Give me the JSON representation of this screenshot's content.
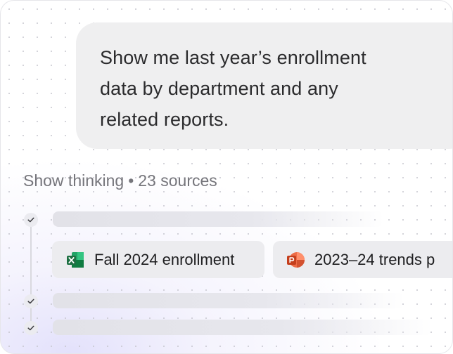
{
  "prompt": {
    "line1": "Show me last year’s enrollment",
    "line2": "data by department and any",
    "line3": "related reports."
  },
  "thinking": {
    "toggle_label": "Show thinking",
    "separator": "•",
    "sources_label": "23 sources"
  },
  "sources": [
    {
      "icon": "excel-icon",
      "label": "Fall 2024 enrollment"
    },
    {
      "icon": "powerpoint-icon",
      "label": "2023–24 trends p"
    }
  ],
  "colors": {
    "excel_green": "#1d6f42",
    "powerpoint_red": "#c43e1c",
    "bubble_bg": "#efeff0",
    "chip_bg": "#ececef"
  }
}
